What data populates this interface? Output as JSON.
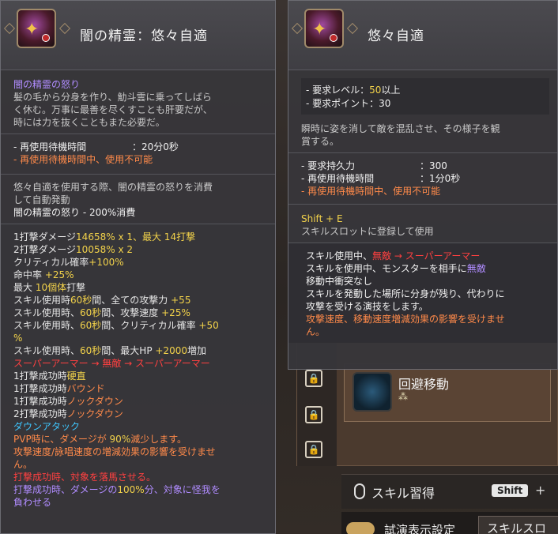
{
  "left_tooltip": {
    "title": "闇の精霊：悠々自適",
    "flavor_title": "闇の精霊の怒り",
    "flavor_text": [
      "髪の毛から分身を作り、觔斗雲に乗ってしばら",
      "く休む。万事に最善を尽くすことも肝要だが、",
      "時には力を抜くこともまた必要だ。"
    ],
    "cooldown_label": "- 再使用待機時間",
    "cooldown_value": "：20分0秒",
    "cooldown_note": "- 再使用待機時間中、使用不可能",
    "consume_text": [
      "悠々自適を使用する際、闇の精霊の怒りを消費",
      "して自動発動"
    ],
    "consume_value": "闇の精霊の怒り - 200%消費",
    "stats": {
      "l1_a": "1打撃ダメージ",
      "l1_b": "14658% x 1、最大 14打撃",
      "l2_a": "2打撃ダメージ",
      "l2_b": "10058% x 2",
      "l3_a": "クリティカル確率",
      "l3_b": "+100%",
      "l4_a": "命中率 ",
      "l4_b": "+25%",
      "l5_a": "最大 ",
      "l5_b": "10個体",
      "l5_c": "打撃",
      "l6_a": "スキル使用時",
      "l6_b": "60秒",
      "l6_c": "間、全ての攻撃力 ",
      "l6_d": "+55",
      "l7_a": "スキル使用時、",
      "l7_b": "60秒",
      "l7_c": "間、攻撃速度 ",
      "l7_d": "+25%",
      "l8_a": "スキル使用時、",
      "l8_b": "60秒",
      "l8_c": "間、クリティカル確率 ",
      "l8_d": "+50",
      "l8_e": "%",
      "l9_a": "スキル使用時、",
      "l9_b": "60秒",
      "l9_c": "間、最大HP ",
      "l9_d": "+2000",
      "l9_e": "増加",
      "l10": "スーパーアーマー → 無敵 → スーパーアーマー",
      "l11_a": "1打撃成功時",
      "l11_b": "硬直",
      "l12_a": "1打撃成功時",
      "l12_b": "バウンド",
      "l13_a": "1打撃成功時",
      "l13_b": "ノックダウン",
      "l14_a": "2打撃成功時",
      "l14_b": "ノックダウン",
      "l15": "ダウンアタック",
      "l16_a": "PVP時に、ダメージが ",
      "l16_b": "90%",
      "l16_c": "減少します。",
      "l17": "攻撃速度/詠唱速度の増減効果の影響を受けませ",
      "l17b": "ん。",
      "l18": "打撃成功時、対象を落馬させる。",
      "l19_a": "打撃成功時、ダメージの",
      "l19_b": "100%",
      "l19_c": "分、対象に怪我を",
      "l19_d": "負わせる"
    }
  },
  "right_tooltip": {
    "title": "悠々自適",
    "req_level_label": "- 要求レベル：",
    "req_level_value": "50",
    "req_level_suffix": "以上",
    "req_point": "- 要求ポイント：30",
    "desc": [
      "瞬時に姿を消して敵を混乱させ、その様子を観",
      "賞する。"
    ],
    "durability_label": "- 要求持久力",
    "durability_value": "：300",
    "cooldown_label": "- 再使用待機時間",
    "cooldown_value": "：1分0秒",
    "cooldown_note": "- 再使用待機時間中、使用不可能",
    "shortcut": "Shift + E",
    "shortcut_note": "スキルスロットに登録して使用",
    "effects": {
      "e1_a": "スキル使用中、",
      "e1_b": "無敵 → スーパーアーマー",
      "e2_a": "スキルを使用中、モンスターを相手に",
      "e2_b": "無敵",
      "e3": "移動中衝突なし",
      "e4": "スキルを発動した場所に分身が残り、代わりに",
      "e5": "攻撃を受ける演技をします。",
      "e6": "攻撃速度、移動速度増減効果の影響を受けませ",
      "e6b": "ん。"
    }
  },
  "background": {
    "skill_name": "回避移動",
    "learn_label": "スキル習得",
    "shift_key": "Shift",
    "plus": "+",
    "demo_label": "試演表示設定",
    "slot_button": "スキルスロ"
  }
}
